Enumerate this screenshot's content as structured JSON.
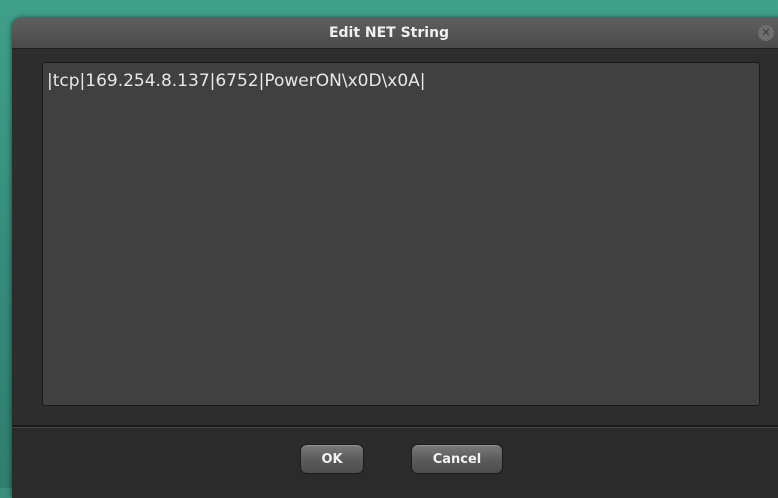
{
  "dialog": {
    "title": "Edit NET String",
    "close_icon": "close-x-icon",
    "editor": {
      "value": "|tcp|169.254.8.137|6752|PowerON\\x0D\\x0A|"
    },
    "buttons": {
      "ok_label": "OK",
      "cancel_label": "Cancel"
    }
  },
  "colors": {
    "backdrop": "#3a8f7e",
    "dialog_bg": "#2d2d2d",
    "editor_bg": "#404040",
    "text": "#e8e8e8"
  }
}
